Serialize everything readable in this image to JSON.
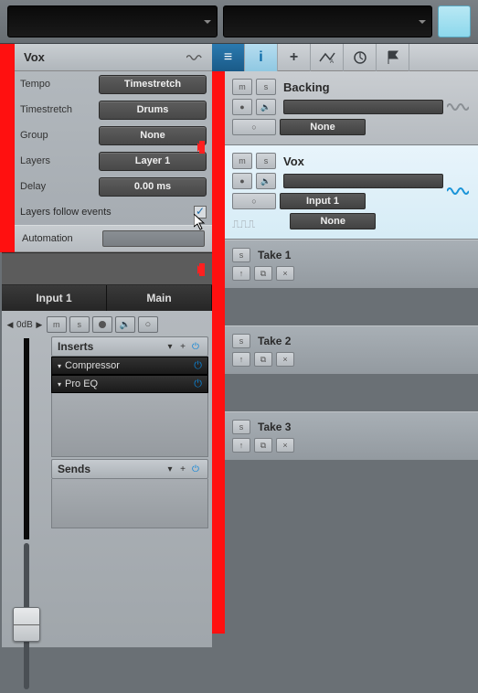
{
  "track_name": "Vox",
  "params": {
    "tempo_label": "Tempo",
    "tempo_value": "Timestretch",
    "timestretch_label": "Timestretch",
    "timestretch_value": "Drums",
    "group_label": "Group",
    "group_value": "None",
    "layers_label": "Layers",
    "layers_value": "Layer 1",
    "delay_label": "Delay",
    "delay_value": "0.00 ms",
    "follow_label": "Layers follow events",
    "automation_label": "Automation"
  },
  "outputs": {
    "in": "Input 1",
    "main": "Main"
  },
  "db_label": "0dB",
  "rack": {
    "inserts_label": "Inserts",
    "compressor": "Compressor",
    "proeq": "Pro EQ",
    "sends_label": "Sends"
  },
  "tracks": {
    "backing": {
      "name": "Backing",
      "assign": "None"
    },
    "vox": {
      "name": "Vox",
      "input": "Input 1",
      "assign": "None"
    }
  },
  "takes": {
    "t1": "Take 1",
    "t2": "Take 2",
    "t3": "Take 3"
  },
  "btn_labels": {
    "m": "m",
    "s": "s",
    "up": "↑",
    "dup": "⧉",
    "close": "×"
  }
}
